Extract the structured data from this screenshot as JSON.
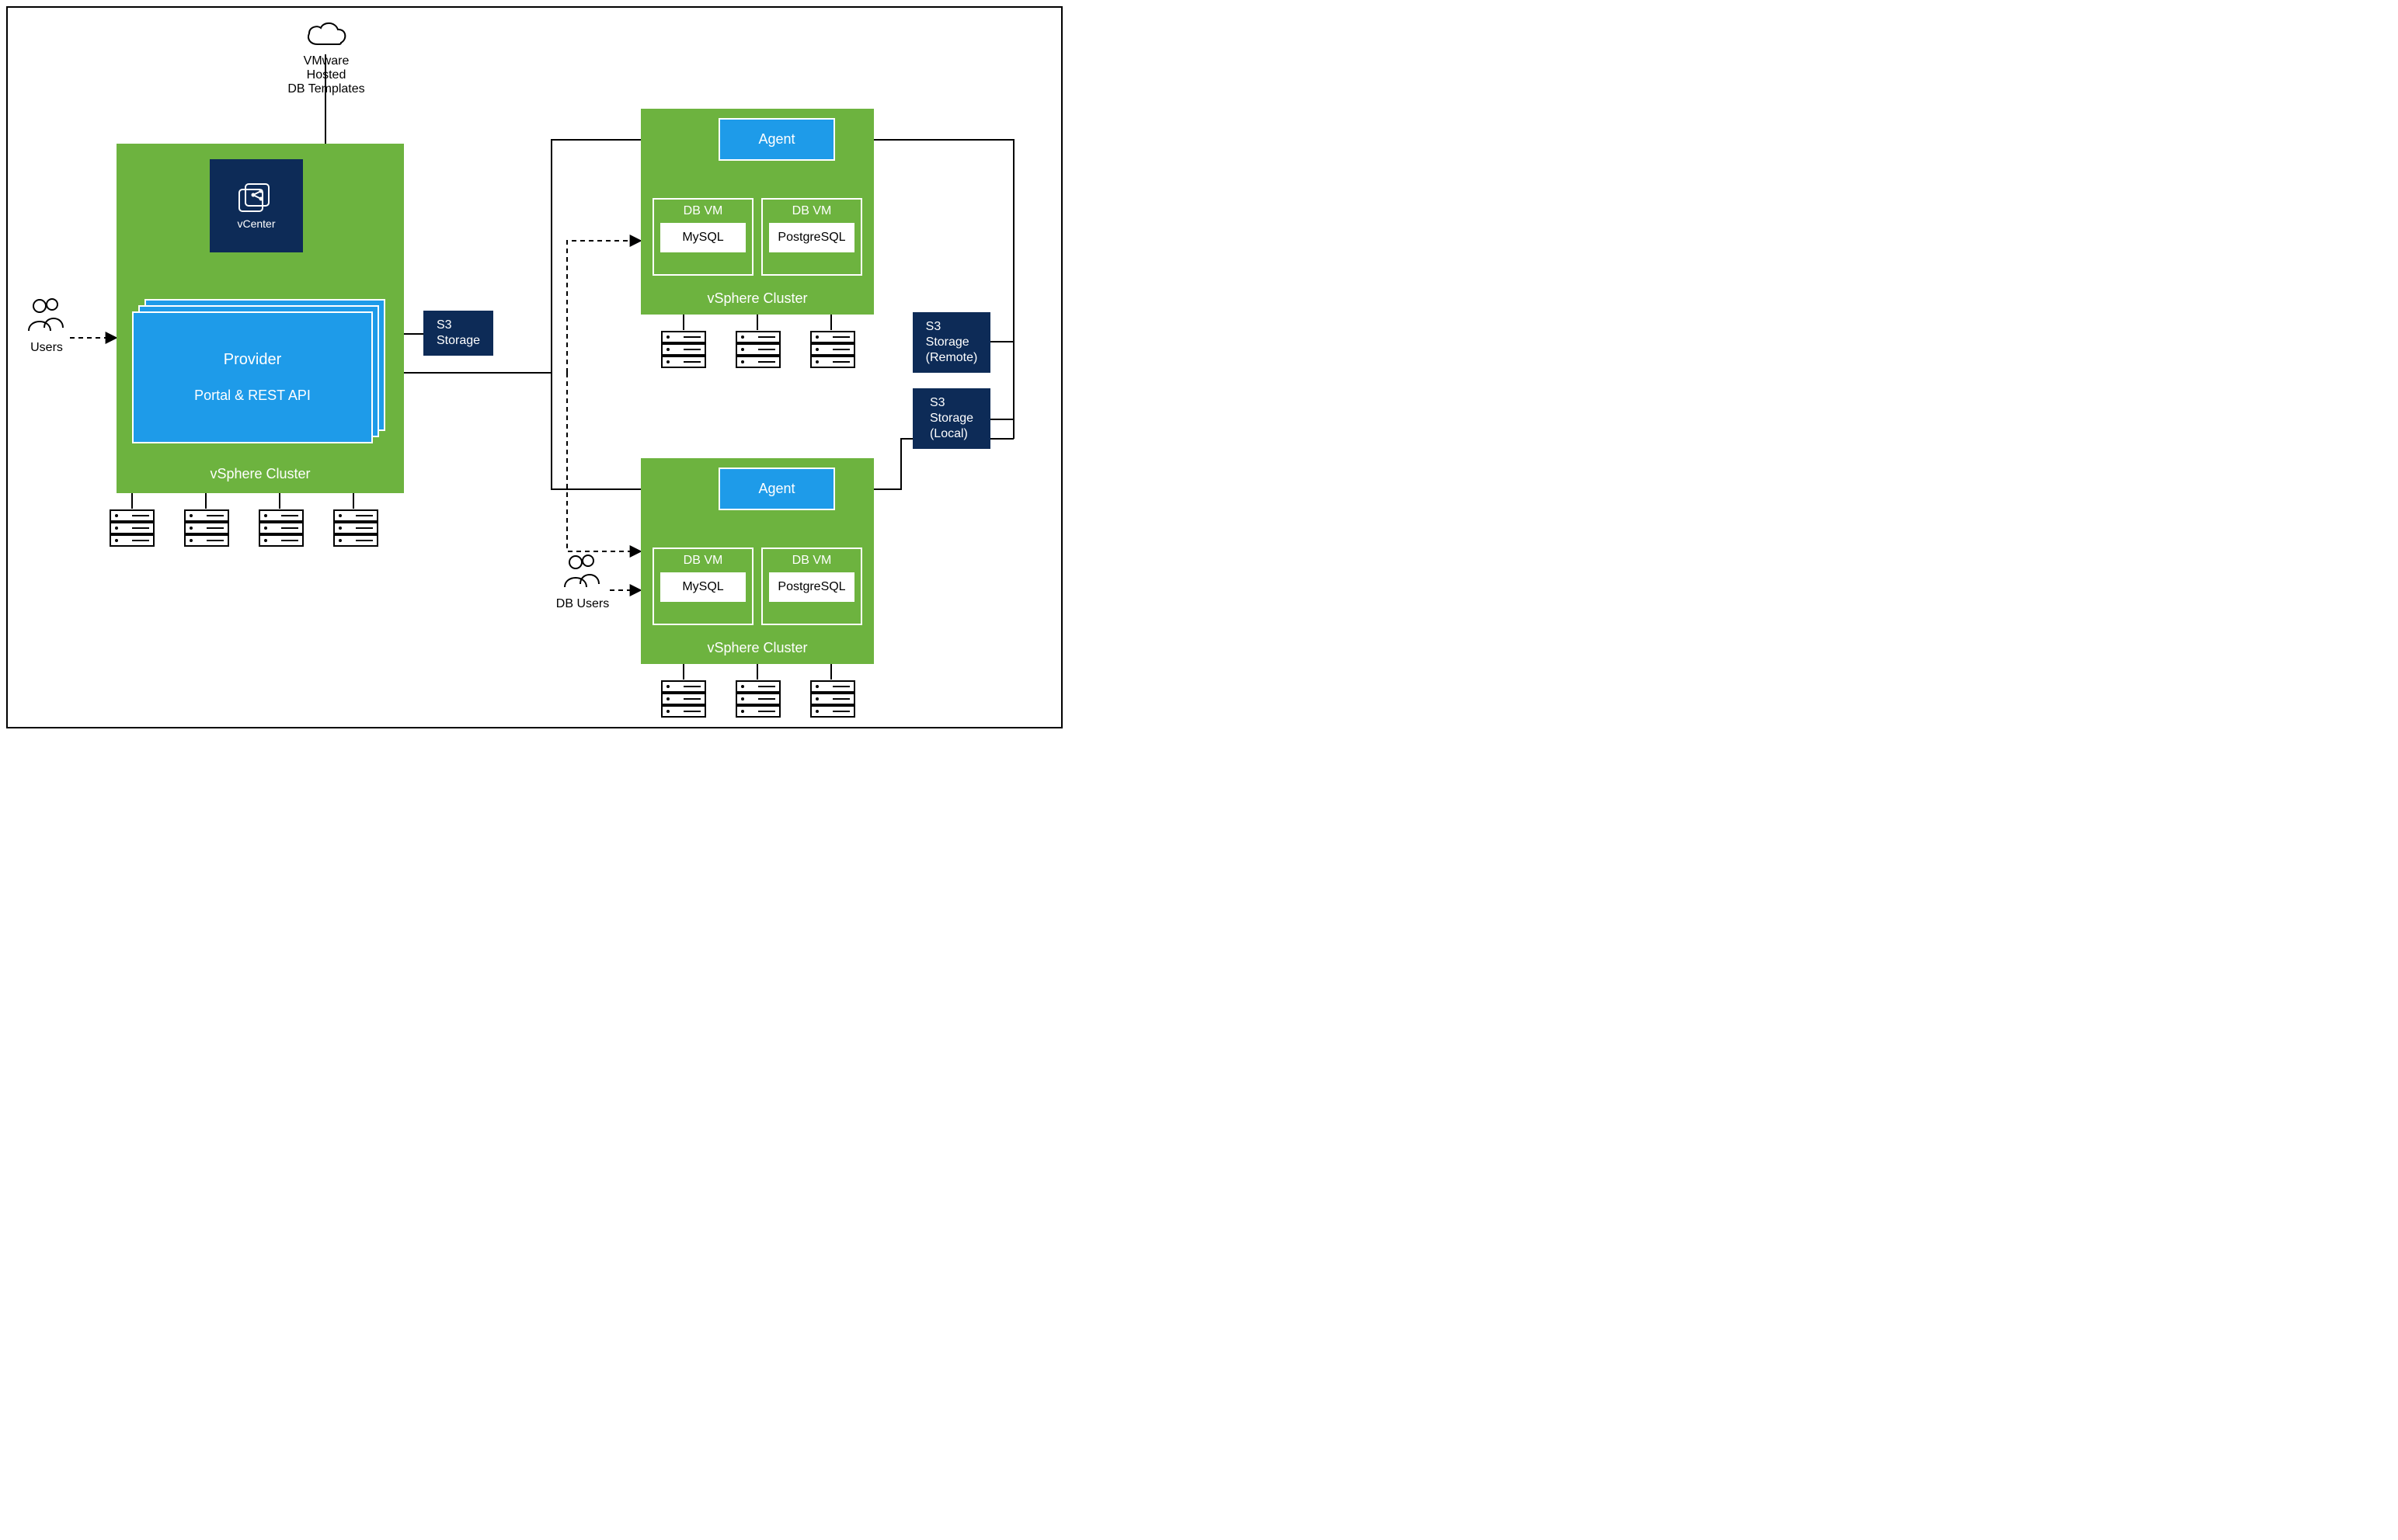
{
  "cloud": {
    "label": "VMware Hosted\nDB Templates"
  },
  "users": {
    "label": "Users"
  },
  "dbusers": {
    "label": "DB Users"
  },
  "leftCluster": {
    "label": "vSphere Cluster",
    "vcenter": "vCenter",
    "provider": {
      "title": "Provider",
      "subtitle": "Portal & REST API"
    }
  },
  "s3": {
    "label": "S3\nStorage"
  },
  "s3remote": {
    "label": "S3\nStorage\n(Remote)"
  },
  "s3local": {
    "label": "S3\nStorage\n(Local)"
  },
  "clusterA": {
    "agent": "Agent",
    "dbvm1": {
      "label": "DB VM",
      "db": "MySQL"
    },
    "dbvm2": {
      "label": "DB VM",
      "db": "PostgreSQL"
    },
    "label": "vSphere Cluster"
  },
  "clusterB": {
    "agent": "Agent",
    "dbvm1": {
      "label": "DB VM",
      "db": "MySQL"
    },
    "dbvm2": {
      "label": "DB VM",
      "db": "PostgreSQL"
    },
    "label": "vSphere Cluster"
  }
}
